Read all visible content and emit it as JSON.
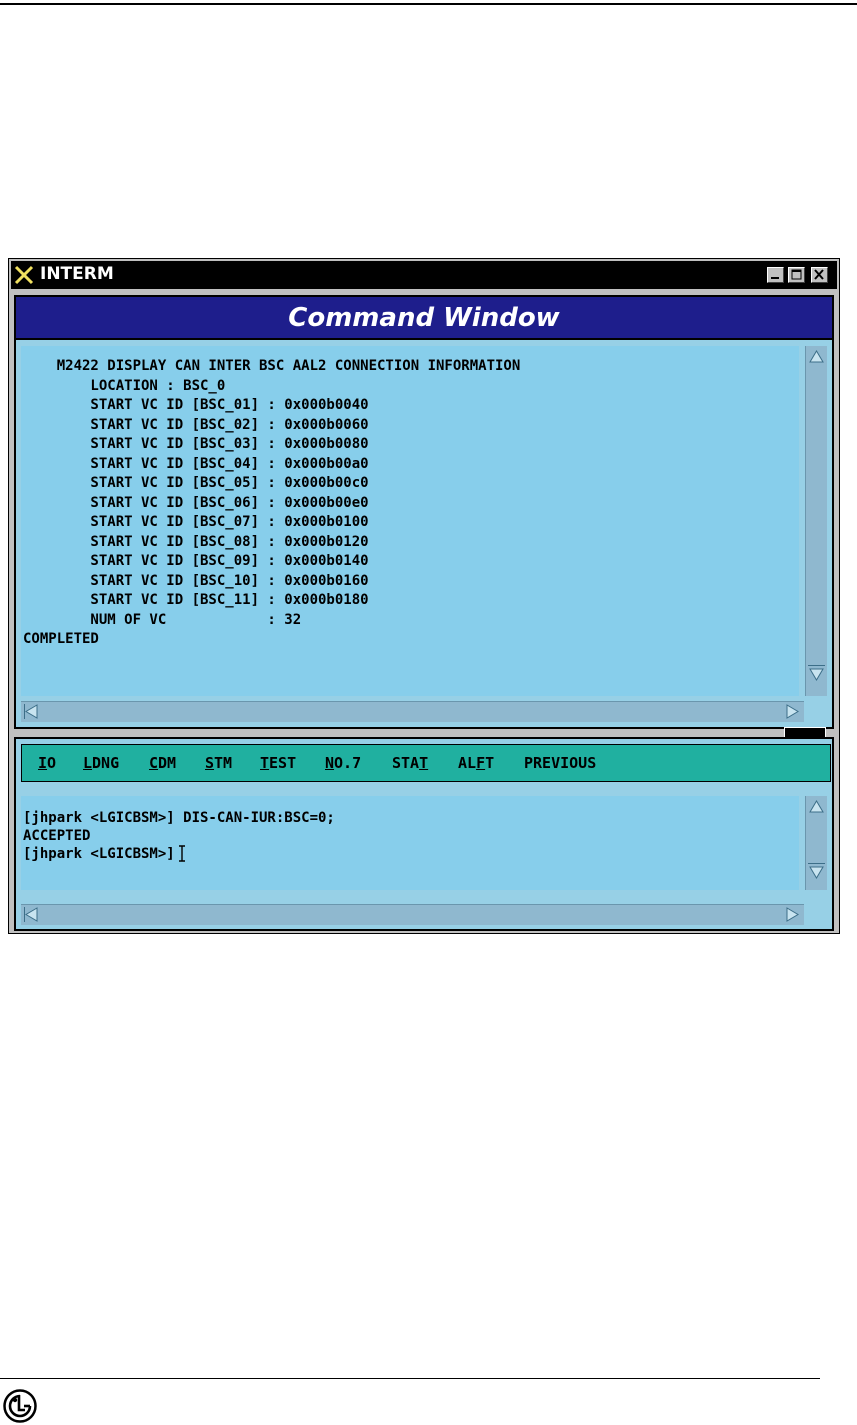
{
  "window": {
    "title": "INTERM",
    "minimize_icon": "minimize-icon",
    "maximize_icon": "maximize-icon",
    "close_icon": "close-icon"
  },
  "header": {
    "title": "Command Window"
  },
  "output": {
    "lines": [
      "    M2422 DISPLAY CAN INTER BSC AAL2 CONNECTION INFORMATION",
      "        LOCATION : BSC_0",
      "        START VC ID [BSC_01] : 0x000b0040",
      "        START VC ID [BSC_02] : 0x000b0060",
      "        START VC ID [BSC_03] : 0x000b0080",
      "        START VC ID [BSC_04] : 0x000b00a0",
      "        START VC ID [BSC_05] : 0x000b00c0",
      "        START VC ID [BSC_06] : 0x000b00e0",
      "        START VC ID [BSC_07] : 0x000b0100",
      "        START VC ID [BSC_08] : 0x000b0120",
      "        START VC ID [BSC_09] : 0x000b0140",
      "        START VC ID [BSC_10] : 0x000b0160",
      "        START VC ID [BSC_11] : 0x000b0180",
      "        NUM OF VC            : 32",
      "COMPLETED"
    ]
  },
  "menu": {
    "items": [
      {
        "mnemonic": "I",
        "rest": "O"
      },
      {
        "mnemonic": "L",
        "rest": "DNG"
      },
      {
        "mnemonic": "C",
        "rest": "DM"
      },
      {
        "mnemonic": "S",
        "rest": "TM"
      },
      {
        "mnemonic": "T",
        "rest": "EST"
      },
      {
        "mnemonic": "N",
        "rest": "O.7"
      },
      {
        "pre": "STA",
        "mnemonic": "T"
      },
      {
        "pre": "AL",
        "mnemonic": "F",
        "rest": "T"
      },
      {
        "label": "PREVIOUS"
      }
    ]
  },
  "command": {
    "lines": [
      "[jhpark <LGICBSM>] DIS-CAN-IUR:BSC=0;",
      "ACCEPTED",
      "[jhpark <LGICBSM>]"
    ]
  },
  "colors": {
    "titlebar": "#000000",
    "header_bar": "#1e1e8c",
    "output_bg": "#87ceeb",
    "menubar": "#20b0a0"
  }
}
